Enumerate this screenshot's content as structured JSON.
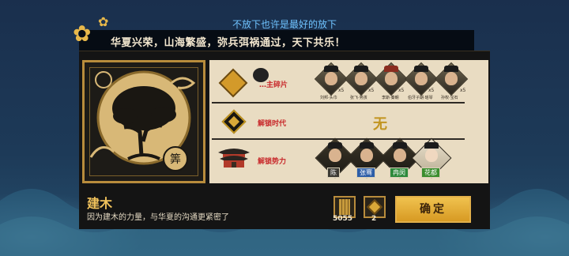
{
  "notice": "不放下也许是最好的放下",
  "banner": "华夏兴荣，山海繁盛，弥兵弭祸通过，天下共乐！",
  "card": {
    "title": "建木",
    "description": "因为建木的力量，与华夏的沟通更紧密了",
    "emblem_glyph": "筭"
  },
  "rows": {
    "fragments": {
      "label": "…主碎片",
      "figures": [
        {
          "name": "刘邦·头巾",
          "count": "x5"
        },
        {
          "name": "张飞·男孩",
          "count": "x5"
        },
        {
          "name": "李斯·秦朝",
          "count": "x5"
        },
        {
          "name": "伯牙子期·瑶琴",
          "count": "x5"
        },
        {
          "name": "孙权·宝石",
          "count": "x5"
        }
      ]
    },
    "era": {
      "label": "解锁时代",
      "value": "无"
    },
    "forces": {
      "label": "解锁势力",
      "leaders": [
        {
          "tag": "陈",
          "color": "#3c3a34"
        },
        {
          "tag": "张骞",
          "color": "#2d5ea8"
        },
        {
          "tag": "冉闵",
          "color": "#2e8a3c"
        },
        {
          "tag": "花都",
          "color": "#3b8e2f"
        }
      ]
    }
  },
  "resources": [
    {
      "icon": "bamboo-scroll-icon",
      "value": "5055"
    },
    {
      "icon": "gold-diamond-icon",
      "value": "2"
    }
  ],
  "confirm_label": "确定",
  "colors": {
    "gold": "#e2b04a",
    "red": "#c8292b",
    "board": "#e9dcc2"
  }
}
